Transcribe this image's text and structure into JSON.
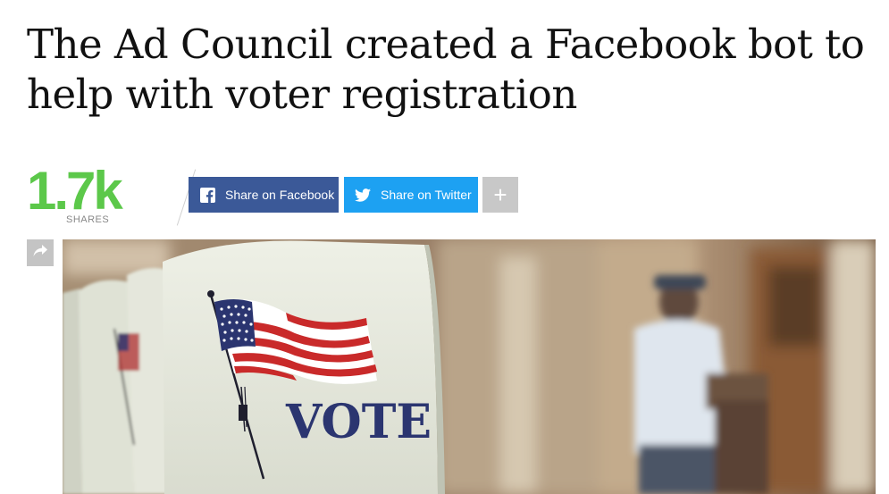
{
  "article": {
    "headline": "The Ad Council created a Facebook bot to help with voter registration"
  },
  "share": {
    "count": "1.7k",
    "count_label": "SHARES",
    "facebook_label": "Share on Facebook",
    "twitter_label": "Share on Twitter",
    "more_label": "+"
  },
  "hero_image": {
    "booth_text": "VOTE"
  },
  "colors": {
    "share_count": "#5cc84a",
    "facebook": "#3b5998",
    "twitter": "#1da1f2",
    "more": "#c8c8c8",
    "side_share": "#c4c4c4"
  },
  "icons": {
    "facebook": "facebook-icon",
    "twitter": "twitter-icon",
    "side_share": "share-arrow-icon"
  }
}
